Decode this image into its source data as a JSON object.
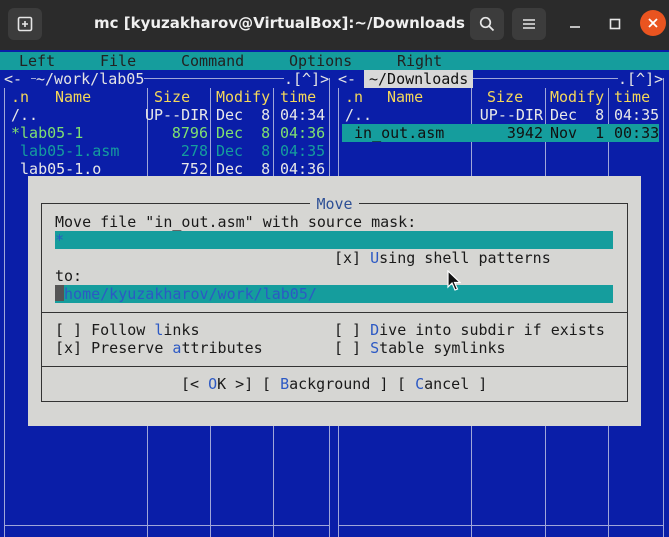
{
  "window": {
    "title": "mc [kyuzakharov@VirtualBox]:~/Downloads",
    "new_tab_icon": "new-tab-icon",
    "search_icon": "search-icon",
    "menu_icon": "hamburger-menu-icon",
    "colors": {
      "terminal_bg": "#0a1ea8",
      "accent": "#159d9d",
      "dialog_bg": "#d6d6d3",
      "close": "#e95420"
    }
  },
  "menubar": {
    "left": "Left",
    "file": "File",
    "command": "Command",
    "options": "Options",
    "right": "Right"
  },
  "left_panel": {
    "path": "~/work/lab05",
    "corner_left": "<- ",
    "corner_right": ".[^]>",
    "headers": {
      "n": ".n",
      "name": "Name",
      "size": "Size",
      "modify": "Modify",
      "time": "time"
    },
    "rows": [
      {
        "name": "/..",
        "size": "UP--DIR",
        "date": "Dec  8",
        "time": "04:34"
      },
      {
        "name": "*lab05-1",
        "size": "8796",
        "date": "Dec  8",
        "time": "04:36"
      },
      {
        "name": " lab05-1.asm",
        "size": "278",
        "date": "Dec  8",
        "time": "04:35"
      },
      {
        "name": " lab05-1.o",
        "size": "752",
        "date": "Dec  8",
        "time": "04:36"
      }
    ]
  },
  "right_panel": {
    "path": "~/Downloads",
    "corner_left": "<- ",
    "corner_right": ".[^]>",
    "headers": {
      "n": ".n",
      "name": "Name",
      "size": "Size",
      "modify": "Modify",
      "time": "time"
    },
    "rows": [
      {
        "name": "/..",
        "size": "UP--DIR",
        "date": "Dec  8",
        "time": "04:35"
      },
      {
        "name": " in_out.asm",
        "size": "3942",
        "date": "Nov  1",
        "time": "00:33"
      }
    ]
  },
  "dialog": {
    "title": "Move",
    "prompt": "Move file \"in_out.asm\" with source mask:",
    "mask_value": "*",
    "shell_patterns": {
      "box": "[x] ",
      "hot": "U",
      "rest": "sing shell patterns"
    },
    "to_label": "to:",
    "to_value": "/home/kyuzakharov/work/lab05/",
    "follow_links": {
      "box": "[ ] ",
      "pre": "Follow ",
      "hot": "l",
      "post": "inks"
    },
    "preserve_attrs": {
      "box": "[x] ",
      "pre": "Preserve ",
      "hot": "a",
      "post": "ttributes"
    },
    "dive_subdir": {
      "box": "[ ] ",
      "pre": "",
      "hot": "D",
      "post": "ive into subdir if exists"
    },
    "stable_symlinks": {
      "box": "[ ] ",
      "pre": "",
      "hot": "S",
      "post": "table symlinks"
    },
    "ok": {
      "open": "[< ",
      "hot": "O",
      "rest": "K >]"
    },
    "background": {
      "open": "[ ",
      "hot": "B",
      "rest": "ackground ]"
    },
    "cancel": {
      "open": "[ ",
      "hot": "C",
      "rest": "ancel ]"
    }
  }
}
